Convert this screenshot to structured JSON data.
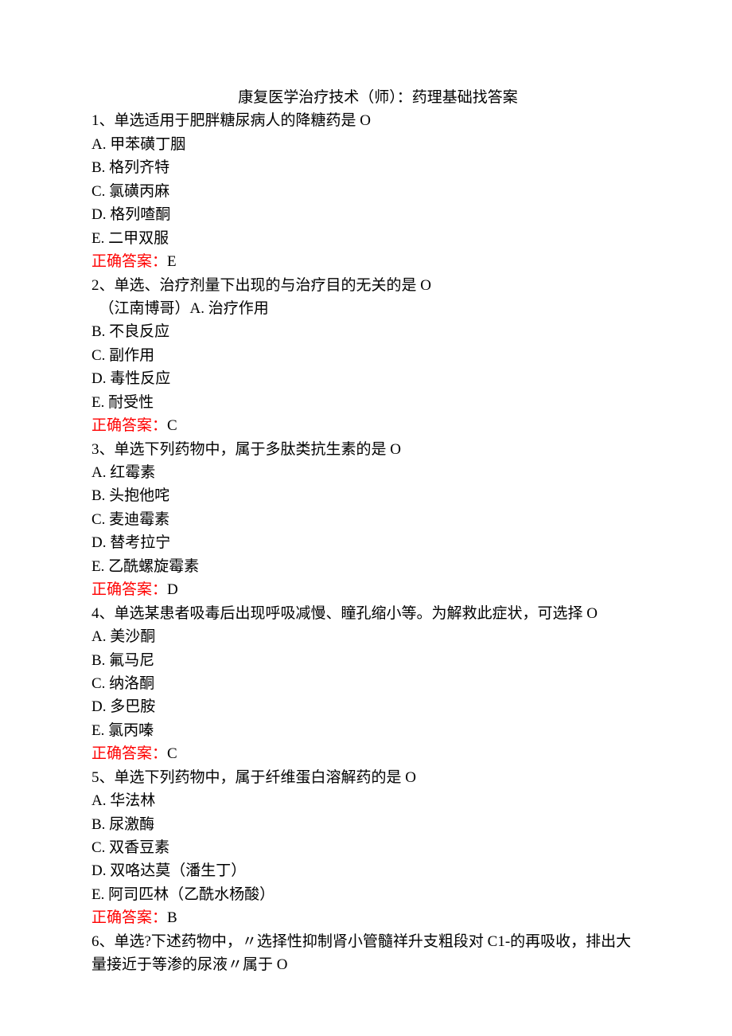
{
  "title": "康复医学治疗技术（师）：药理基础找答案",
  "q1": {
    "stem": "1、单选适用于肥胖糖尿病人的降糖药是 O",
    "a": "A. 甲苯磺丁胭",
    "b": "B. 格列齐特",
    "c": "C. 氯磺丙麻",
    "d": "D. 格列喳酮",
    "e": "E. 二甲双服",
    "answer_label": "正确答案：",
    "answer_value": "E"
  },
  "q2": {
    "stem": "2、单选、治疗剂量下出现的与治疗目的无关的是 O",
    "a_prefix": "　（江南博哥）A. 治疗作用",
    "b": "B. 不良反应",
    "c": "C. 副作用",
    "d": "D. 毒性反应",
    "e": "E. 耐受性",
    "answer_label": "正确答案：",
    "answer_value": "C"
  },
  "q3": {
    "stem": "3、单选下列药物中，属于多肽类抗生素的是 O",
    "a": "A. 红霉素",
    "b": "B. 头抱他咤",
    "c": "C. 麦迪霉素",
    "d": "D. 替考拉宁",
    "e": "E. 乙酰螺旋霉素",
    "answer_label": "正确答案：",
    "answer_value": "D"
  },
  "q4": {
    "stem": "4、单选某患者吸毒后出现呼吸减慢、瞳孔缩小等。为解救此症状，可选择 O",
    "a": "A. 美沙酮",
    "b": "B. 氟马尼",
    "c": "C. 纳洛酮",
    "d": "D. 多巴胺",
    "e": "E. 氯丙嗪",
    "answer_label": "正确答案：",
    "answer_value": "C"
  },
  "q5": {
    "stem": "5、单选下列药物中，属于纤维蛋白溶解药的是 O",
    "a": "A. 华法林",
    "b": "B. 尿激酶",
    "c": "C. 双香豆素",
    "d": "D. 双咯达莫（潘生丁）",
    "e": "E. 阿司匹林（乙酰水杨酸）",
    "answer_label": "正确答案：",
    "answer_value": "B"
  },
  "q6": {
    "stem": "6、单选?下述药物中，〃选择性抑制肾小管髓祥升支粗段对 C1-的再吸收，排出大量接近于等渗的尿液〃属于 O"
  }
}
